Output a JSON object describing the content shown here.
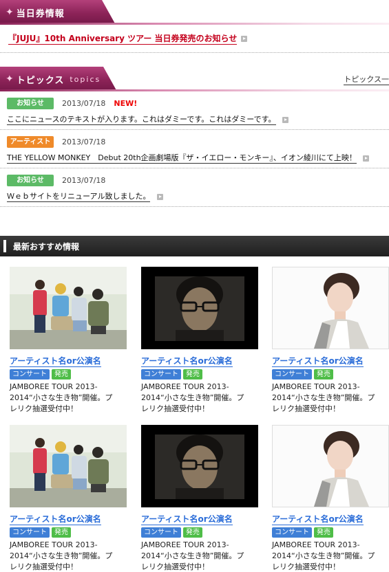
{
  "ticket_section": {
    "title": "当日券情報",
    "link_text": "『JUJU』10th Anniversary ツアー 当日券発売のお知らせ"
  },
  "topics_section": {
    "title": "トピックス",
    "subtitle": "topics",
    "more_link": "トピックス一"
  },
  "topics": [
    {
      "badge": "お知らせ",
      "badge_color": "#5cba66",
      "date": "2013/07/18",
      "new": "NEW!",
      "text": "ここにニュースのテキストが入ります。これはダミーです。これはダミーです。"
    },
    {
      "badge": "アーティスト",
      "badge_color": "#ef8a2a",
      "date": "2013/07/18",
      "new": "",
      "text": "THE YELLOW MONKEY　Debut 20th企画劇場版『ザ・イエロー・モンキー』、イオン綾川にて上映！"
    },
    {
      "badge": "お知らせ",
      "badge_color": "#5cba66",
      "date": "2013/07/18",
      "new": "",
      "text": "Ｗｅｂサイトをリニューアル致しました。"
    }
  ],
  "recommend": {
    "title": "最新おすすめ情報",
    "cards": [
      {
        "name": "アーティスト名or公演名",
        "tag1": "コンサート",
        "tag2": "発売",
        "desc": "JAMBOREE TOUR 2013-2014“小さな生き物”開催。プレリク抽選受付中！",
        "image": "band-group-photo"
      },
      {
        "name": "アーティスト名or公演名",
        "tag1": "コンサート",
        "tag2": "発売",
        "desc": "JAMBOREE TOUR 2013-2014“小さな生き物”開催。プレリク抽選受付中！",
        "image": "man-glasses-portrait"
      },
      {
        "name": "アーティスト名or公演名",
        "tag1": "コンサート",
        "tag2": "発売",
        "desc": "JAMBOREE TOUR 2013-2014“小さな生き物”開催。プレリク抽選受付中！",
        "image": "young-man-portrait"
      },
      {
        "name": "アーティスト名or公演名",
        "tag1": "コンサート",
        "tag2": "発売",
        "desc": "JAMBOREE TOUR 2013-2014“小さな生き物”開催。プレリク抽選受付中！",
        "image": "band-group-photo"
      },
      {
        "name": "アーティスト名or公演名",
        "tag1": "コンサート",
        "tag2": "発売",
        "desc": "JAMBOREE TOUR 2013-2014“小さな生き物”開催。プレリク抽選受付中！",
        "image": "man-glasses-portrait"
      },
      {
        "name": "アーティスト名or公演名",
        "tag1": "コンサート",
        "tag2": "発売",
        "desc": "JAMBOREE TOUR 2013-2014“小さな生き物”開催。プレリク抽選受付中！",
        "image": "young-man-portrait"
      }
    ]
  },
  "colors": {
    "accent": "#8c2358",
    "link_red": "#c4001c",
    "link_blue": "#2a6cd8",
    "badge_green": "#5cba66",
    "badge_orange": "#ef8a2a"
  }
}
